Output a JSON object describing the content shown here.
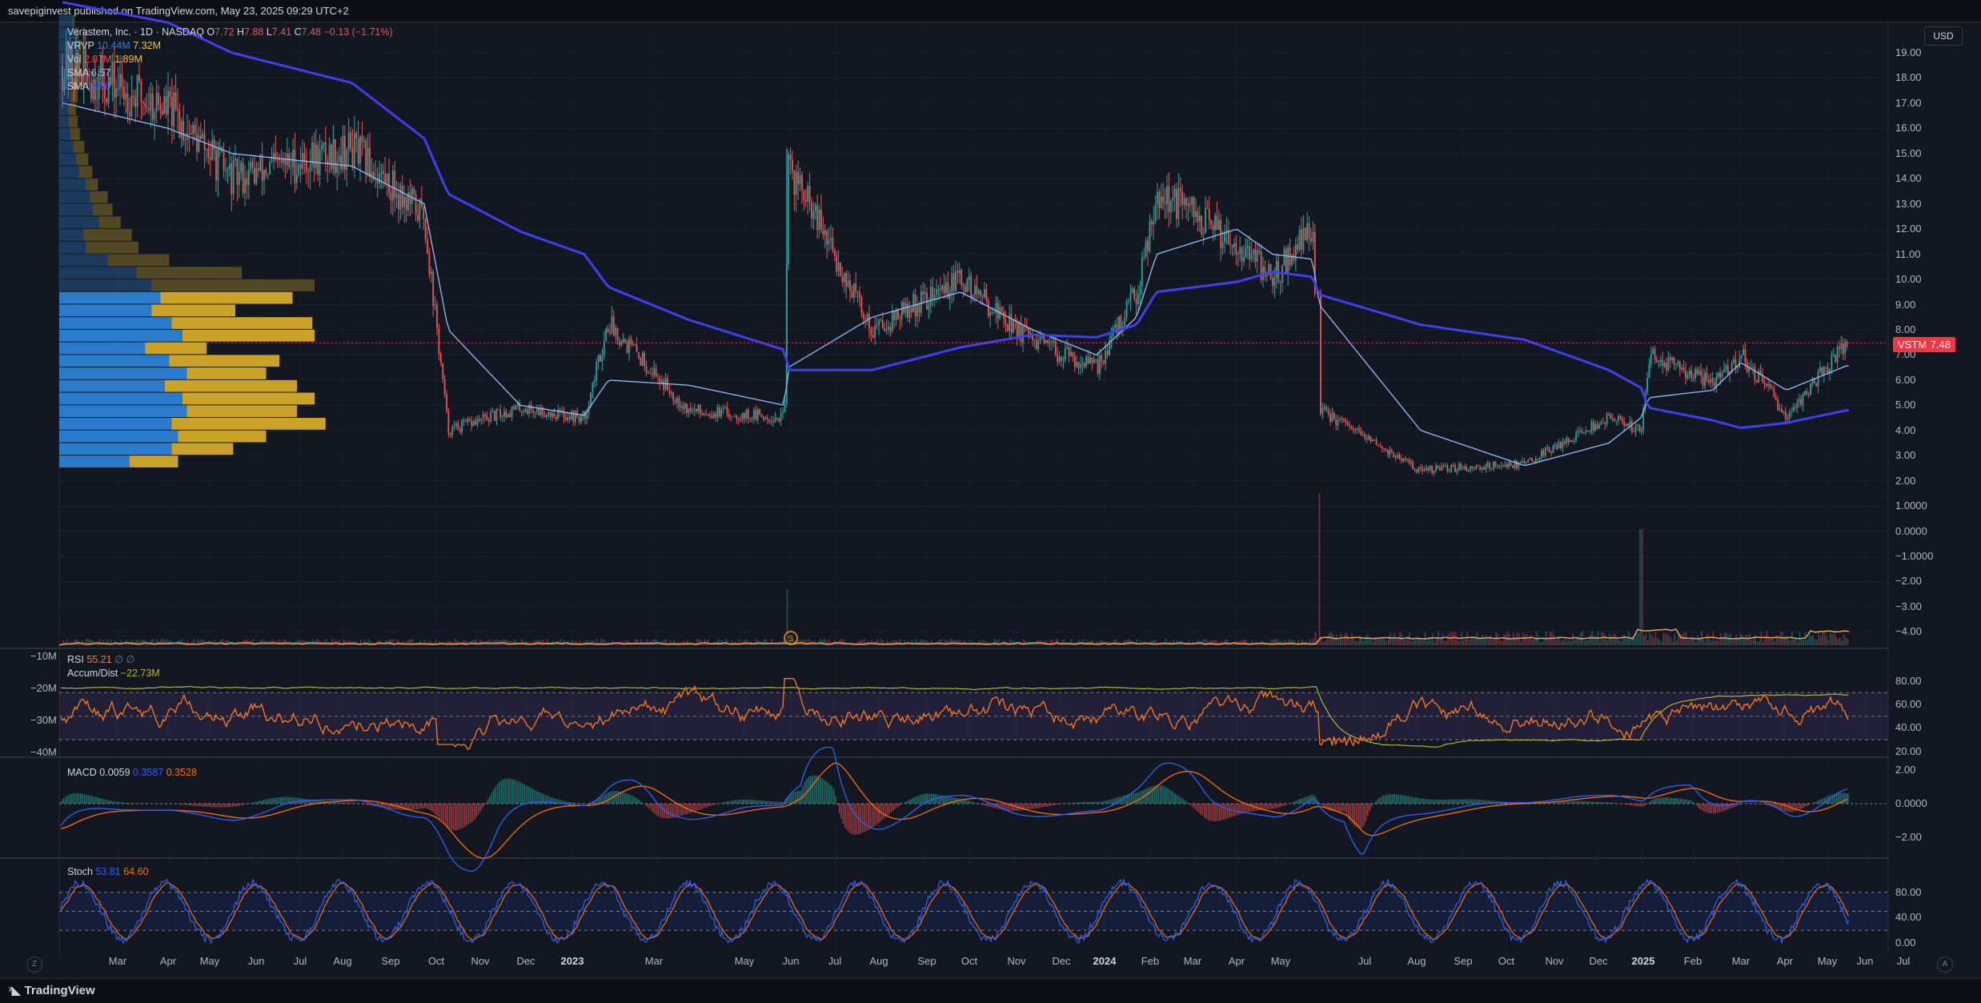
{
  "header": {
    "publish_line": "savepiginvest published on TradingView.com, May 23, 2025 09:29 UTC+2"
  },
  "symbol": {
    "name": "Verastem, Inc.",
    "interval": "1D",
    "exchange": "NASDAQ",
    "open_label": "O",
    "open": "7.72",
    "high_label": "H",
    "high": "7.88",
    "low_label": "L",
    "low": "7.41",
    "close_label": "C",
    "close": "7.48",
    "change": "−0.13 (−1.71%)"
  },
  "legend": {
    "vrvp_label": "VRVP",
    "vrvp_up": "10.44M",
    "vrvp_down": "7.32M",
    "vol_label": "Vol",
    "vol_a": "2.07M",
    "vol_b": "1.89M",
    "sma1_label": "SMA",
    "sma1_value": "6.57",
    "sma2_label": "SMA",
    "sma2_value": "4.80",
    "rsi_label": "RSI",
    "rsi_value": "55.21",
    "rsi_extra": "∅ ∅",
    "ad_label": "Accum/Dist",
    "ad_value": "−22.73M",
    "macd_label": "MACD",
    "macd_a": "0.0059",
    "macd_b": "0.3587",
    "macd_c": "0.3528",
    "stoch_label": "Stoch",
    "stoch_k": "53.81",
    "stoch_d": "64.60"
  },
  "price_tag": {
    "ticker": "VSTM",
    "value": "7.48"
  },
  "currency_button": "USD",
  "price_axis": [
    "19.00",
    "18.00",
    "17.00",
    "16.00",
    "15.00",
    "14.00",
    "13.00",
    "12.00",
    "11.00",
    "10.00",
    "9.00",
    "8.00",
    "7.00",
    "6.00",
    "5.00",
    "4.00",
    "3.00",
    "2.00",
    "1.0000",
    "0.0000",
    "−1.0000",
    "−2.00",
    "−3.00",
    "−4.00"
  ],
  "rsi_axis": [
    "80.00",
    "60.00",
    "40.00",
    "20.00"
  ],
  "ad_axis": [
    "−10M",
    "−20M",
    "−30M",
    "−40M"
  ],
  "macd_axis": [
    "2.00",
    "0.0000",
    "−2.00"
  ],
  "stoch_axis": [
    "80.00",
    "40.00",
    "0.00"
  ],
  "time_axis": [
    {
      "label": "Mar",
      "year": false
    },
    {
      "label": "Apr",
      "year": false
    },
    {
      "label": "May",
      "year": false
    },
    {
      "label": "Jun",
      "year": false
    },
    {
      "label": "Jul",
      "year": false
    },
    {
      "label": "Aug",
      "year": false
    },
    {
      "label": "Sep",
      "year": false
    },
    {
      "label": "Oct",
      "year": false
    },
    {
      "label": "Nov",
      "year": false
    },
    {
      "label": "Dec",
      "year": false
    },
    {
      "label": "2023",
      "year": true
    },
    {
      "label": "Mar",
      "year": false
    },
    {
      "label": "May",
      "year": false
    },
    {
      "label": "Jun",
      "year": false
    },
    {
      "label": "Jul",
      "year": false
    },
    {
      "label": "Aug",
      "year": false
    },
    {
      "label": "Sep",
      "year": false
    },
    {
      "label": "Oct",
      "year": false
    },
    {
      "label": "Nov",
      "year": false
    },
    {
      "label": "Dec",
      "year": false
    },
    {
      "label": "2024",
      "year": true
    },
    {
      "label": "Feb",
      "year": false
    },
    {
      "label": "Mar",
      "year": false
    },
    {
      "label": "Apr",
      "year": false
    },
    {
      "label": "May",
      "year": false
    },
    {
      "label": "Jul",
      "year": false
    },
    {
      "label": "Aug",
      "year": false
    },
    {
      "label": "Sep",
      "year": false
    },
    {
      "label": "Oct",
      "year": false
    },
    {
      "label": "Nov",
      "year": false
    },
    {
      "label": "Dec",
      "year": false
    },
    {
      "label": "2025",
      "year": true
    },
    {
      "label": "Feb",
      "year": false
    },
    {
      "label": "Mar",
      "year": false
    },
    {
      "label": "Apr",
      "year": false
    },
    {
      "label": "May",
      "year": false
    },
    {
      "label": "Jun",
      "year": false
    },
    {
      "label": "Jul",
      "year": false
    }
  ],
  "footer": {
    "brand": "TradingView",
    "zoom_left": "Z",
    "auto_right": "A"
  },
  "event_marker": "S",
  "colors": {
    "up": "#26a69a",
    "down": "#ef5350",
    "sma_fast": "#90bff9",
    "sma_slow": "#3f3ff0",
    "rsi": "#ff7a1a",
    "ad": "#b5b52a",
    "macd": "#2962ff",
    "signal": "#ff6d00",
    "stoch_k": "#2962ff",
    "stoch_d": "#ff6d00",
    "vp_up": "#2a7bcc",
    "vp_down": "#c9a227"
  },
  "chart_data": {
    "type": "line",
    "ticker": "VSTM",
    "x": [
      "2022-02-15",
      "2022-04-01",
      "2022-06-01",
      "2022-08-01",
      "2022-09-20",
      "2022-10-25",
      "2022-12-01",
      "2023-01-10",
      "2023-02-20",
      "2023-04-01",
      "2023-05-20",
      "2023-06-01",
      "2023-07-15",
      "2023-09-01",
      "2023-10-20",
      "2023-12-01",
      "2024-01-20",
      "2024-02-15",
      "2024-03-20",
      "2024-05-01",
      "2024-05-20",
      "2024-06-05",
      "2024-08-01",
      "2024-10-01",
      "2024-11-20",
      "2024-12-20",
      "2025-01-05",
      "2025-02-20",
      "2025-04-05",
      "2025-04-25",
      "2025-05-22"
    ],
    "series": [
      {
        "values": [
          18.5,
          16.8,
          14.0,
          15.2,
          12.5,
          4.0,
          4.9,
          4.5,
          8.3,
          4.8,
          4.5,
          14.5,
          8.0,
          10.0,
          7.5,
          6.5,
          9.5,
          13.5,
          11.5,
          10.0,
          12.2,
          4.8,
          2.4,
          2.7,
          4.5,
          4.0,
          7.0,
          5.9,
          7.0,
          4.6,
          7.48
        ]
      },
      {
        "values": [
          17.0,
          16.0,
          15.0,
          14.5,
          13.0,
          8.0,
          5.0,
          4.6,
          6.0,
          5.8,
          5.0,
          6.5,
          8.5,
          9.5,
          8.0,
          7.0,
          8.5,
          11.0,
          12.0,
          11.0,
          10.8,
          9.0,
          4.0,
          2.6,
          3.5,
          4.5,
          5.3,
          5.6,
          6.7,
          5.6,
          6.57
        ]
      },
      {
        "values": [
          21.0,
          20.2,
          19.0,
          17.8,
          15.6,
          13.4,
          11.9,
          11.0,
          9.7,
          8.4,
          7.2,
          6.4,
          6.4,
          7.3,
          7.8,
          7.7,
          8.2,
          9.5,
          9.9,
          10.3,
          10.1,
          9.4,
          8.2,
          7.6,
          6.4,
          5.7,
          4.9,
          4.4,
          4.1,
          4.3,
          4.8
        ]
      }
    ],
    "ylim": [
      -4,
      20
    ]
  }
}
